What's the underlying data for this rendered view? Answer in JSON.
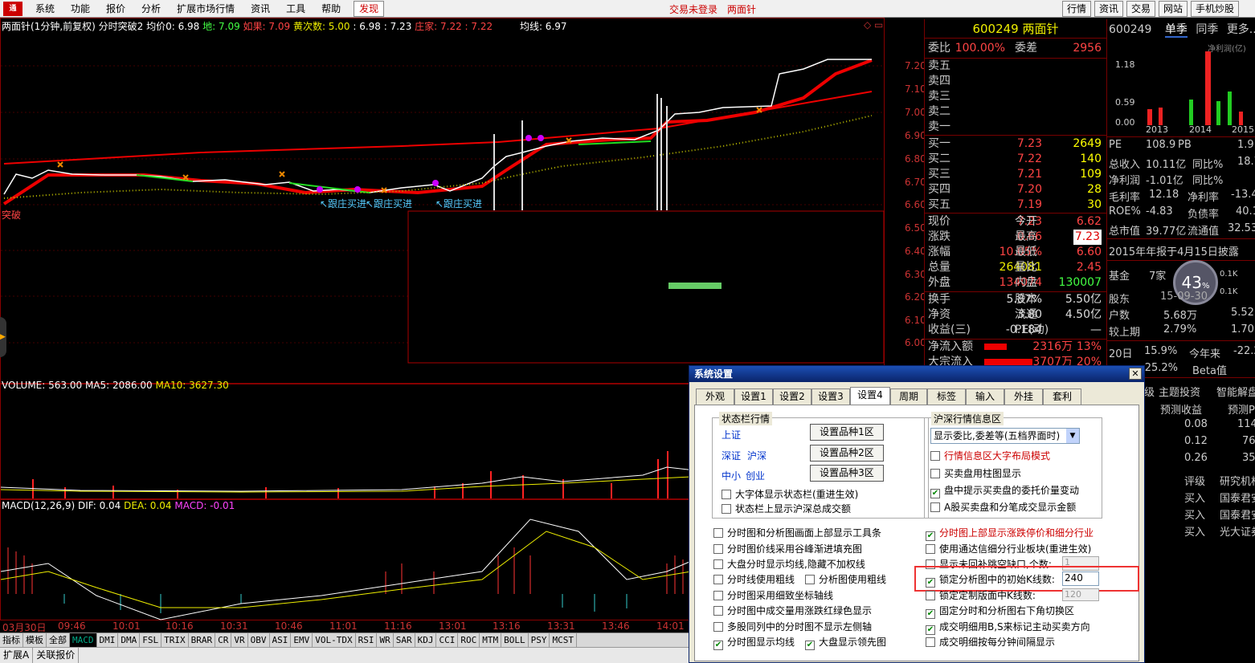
{
  "menubar": {
    "logo": "通",
    "items": [
      "系统",
      "功能",
      "报价",
      "分析",
      "扩展市场行情",
      "资讯",
      "工具",
      "帮助"
    ],
    "find": "发现",
    "trade_status": "交易未登录",
    "trade_name": "两面针",
    "right_buttons": [
      "行情",
      "资讯",
      "交易",
      "网站",
      "手机炒股"
    ]
  },
  "chart": {
    "info_name": "两面针(1分钟,前复权) 分时突破2",
    "info_avg": "均价0: 6.98",
    "info_di": "地: 7.09",
    "info_ru": "如果: 7.09",
    "info_huang": "黄次数: 5.00",
    "info_vals": ": 6.98 : 7.23",
    "info_zhuang": "庄家: 7.22 : 7.22",
    "info_junxian": "均线: 6.97",
    "price_ticks": [
      "7.20",
      "7.10",
      "7.00",
      "6.90",
      "6.80",
      "6.70",
      "6.60",
      "6.50",
      "6.40",
      "6.30",
      "6.20",
      "6.10",
      "6.00"
    ],
    "labels": {
      "tupo": "突破",
      "gen1": "↖跟庄买进",
      "gen2": "↖跟庄买进",
      "gen3": "↖跟庄买进"
    },
    "volume_info": "VOLUME: 563.00",
    "volume_ma5": "MA5: 2086.00",
    "volume_ma10": "MA10: 3627.30",
    "macd_info": "MACD(12,26,9)",
    "macd_dif": "DIF: 0.04",
    "macd_dea": "DEA: 0.04",
    "macd_val": "MACD: -0.01",
    "time_ticks": [
      "03月30日",
      "09:46",
      "10:01",
      "10:16",
      "10:31",
      "10:46",
      "11:01",
      "11:16",
      "13:01",
      "13:16",
      "13:31",
      "13:46",
      "14:01"
    ]
  },
  "quote": {
    "code": "600249",
    "name": "两面针",
    "weibi_label": "委比",
    "weibi": "100.00%",
    "weicha_label": "委差",
    "weicha": "2956",
    "sell": [
      "卖五",
      "卖四",
      "卖三",
      "卖二",
      "卖一"
    ],
    "buy": [
      {
        "l": "买一",
        "p": "7.23",
        "v": "2649"
      },
      {
        "l": "买二",
        "p": "7.22",
        "v": "140"
      },
      {
        "l": "买三",
        "p": "7.21",
        "v": "109"
      },
      {
        "l": "买四",
        "p": "7.20",
        "v": "28"
      },
      {
        "l": "买五",
        "p": "7.19",
        "v": "30"
      }
    ],
    "stats": [
      {
        "l": "现价",
        "v": "7.23",
        "l2": "今开",
        "v2": "6.62"
      },
      {
        "l": "涨跌",
        "v": "0.66",
        "l2": "最高",
        "v2": "7.23"
      },
      {
        "l": "涨幅",
        "v": "10.05%",
        "l2": "最低",
        "v2": "6.60"
      },
      {
        "l": "总量",
        "v": "264081",
        "l2": "量比",
        "v2": "2.45"
      },
      {
        "l": "外盘",
        "v": "134074",
        "l2": "内盘",
        "v2": "130007"
      },
      {
        "l": "换手",
        "v": "5.87%",
        "l2": "股本",
        "v2": "5.50亿"
      },
      {
        "l": "净资",
        "v": "3.80",
        "l2": "流通",
        "v2": "4.50亿"
      },
      {
        "l": "收益(三)",
        "v": "-0.184",
        "l2": "PE(动)",
        "v2": "—"
      }
    ],
    "flow1_label": "净流入额",
    "flow1": "2316万",
    "flow1_pct": "13%",
    "flow2_label": "大宗流入",
    "flow2": "3707万",
    "flow2_pct": "20%"
  },
  "fundamental": {
    "code": "600249",
    "tabs": [
      "单季",
      "同季",
      "更多..."
    ],
    "chart_title": "净利润(亿)",
    "yticks": [
      "1.18",
      "0.59",
      "0.00"
    ],
    "years": [
      "2013",
      "2014",
      "2015"
    ],
    "rows": [
      [
        "PE",
        "108.9",
        "PB",
        "1.9"
      ],
      [
        "总收入",
        "10.11亿",
        "同比%",
        "18.7"
      ],
      [
        "净利润",
        "-1.01亿",
        "同比%",
        ""
      ],
      [
        "毛利率",
        "12.18",
        "净利率",
        "-13.4"
      ],
      [
        "ROE%",
        "-4.83",
        "负债率",
        "40.1"
      ],
      [
        "总市值",
        "39.77亿",
        "流通值",
        "32.53"
      ]
    ],
    "report": "2015年年报于4月15日披露",
    "fund_l": "基金",
    "fund_v": "7家",
    "gauge": "43",
    "gauge_suffix": "%",
    "g1": "0.1K",
    "g2": "0.1K",
    "holders_l": "股东",
    "holders_v": "15-09-30",
    "hu_l": "户数",
    "hu_v": "5.68万",
    "hu_v2": "5.52",
    "ji_l": "较上期",
    "ji_v": "2.79%",
    "ji_v2": "1.70",
    "d20_l": "20日",
    "d20_v": "15.9%",
    "jn_l": "今年来",
    "jn_v": "-22.2",
    "d20_v2": "-25.2%",
    "beta_l": "Beta值",
    "invest_tabs": [
      "级",
      "主题投资",
      "智能解盘"
    ],
    "pred_h1": "预测收益",
    "pred_h2": "预测P",
    "pred": [
      [
        "0.08",
        "114"
      ],
      [
        "0.12",
        "76"
      ],
      [
        "0.26",
        "35"
      ]
    ],
    "rate_h1": "评级",
    "rate_h2": "研究机构",
    "rates": [
      [
        "买入",
        "国泰君安"
      ],
      [
        "买入",
        "国泰君安"
      ],
      [
        "买入",
        "光大证券"
      ]
    ]
  },
  "dialog": {
    "title": "系统设置",
    "close": "✕",
    "tabs": [
      "外观",
      "设置1",
      "设置2",
      "设置3",
      "设置4",
      "周期",
      "标签",
      "输入",
      "外挂",
      "套利"
    ],
    "status_group": "状态栏行情",
    "links": [
      "上证",
      "深证",
      "沪深",
      "中小",
      "创业"
    ],
    "set_buttons": [
      "设置品种1区",
      "设置品种2区",
      "设置品种3区"
    ],
    "status_cbs": [
      "大字体显示状态栏(重进生效)",
      "状态栏上显示沪深总成交额"
    ],
    "hs_group": "沪深行情信息区",
    "hs_select": "显示委比,委差等(五档界面时)",
    "hs_cbs": [
      "行情信息区大字布局模式",
      "买卖盘用柱图显示",
      "盘中提示买卖盘的委托价量变动",
      "A股买卖盘和分笔成交显示金额"
    ],
    "left_cbs": [
      "分时图和分析图画面上部显示工具条",
      "分时图价线采用谷峰渐进填充图",
      "大盘分时显示均线,隐藏不加权线",
      "分时线使用粗线",
      "分时图采用细致坐标轴线",
      "分时图中成交量用涨跌红绿色显示",
      "多股同列中的分时图不显示左侧轴",
      "分时图显示均线"
    ],
    "left_extra1": "分析图使用粗线",
    "left_extra2": "大盘显示领先图",
    "right_cbs": [
      "分时图上部显示涨跌停价和细分行业",
      "使用通达信细分行业板块(重进生效)",
      "显示未回补跳空缺口,个数:",
      "锁定分析图中的初始K线数:",
      "锁定定制版面中K线数:",
      "固定分时和分析图右下角切换区",
      "成交明细用B,S来标记主动买卖方向",
      "成交明细按每分钟间隔显示"
    ],
    "lock_value": "240",
    "gap_value": "1",
    "custom_value": "120"
  },
  "bottom": {
    "tabs": [
      "指标",
      "模板",
      "全部",
      "MACD",
      "DMI",
      "DMA",
      "FSL",
      "TRIX",
      "BRAR",
      "CR",
      "VR",
      "OBV",
      "ASI",
      "EMV",
      "VOL-TDX",
      "RSI",
      "WR",
      "SAR",
      "KDJ",
      "CCI",
      "ROC",
      "MTM",
      "BOLL",
      "PSY",
      "MCST"
    ],
    "tabs2": [
      "扩展A",
      "关联报价"
    ]
  }
}
